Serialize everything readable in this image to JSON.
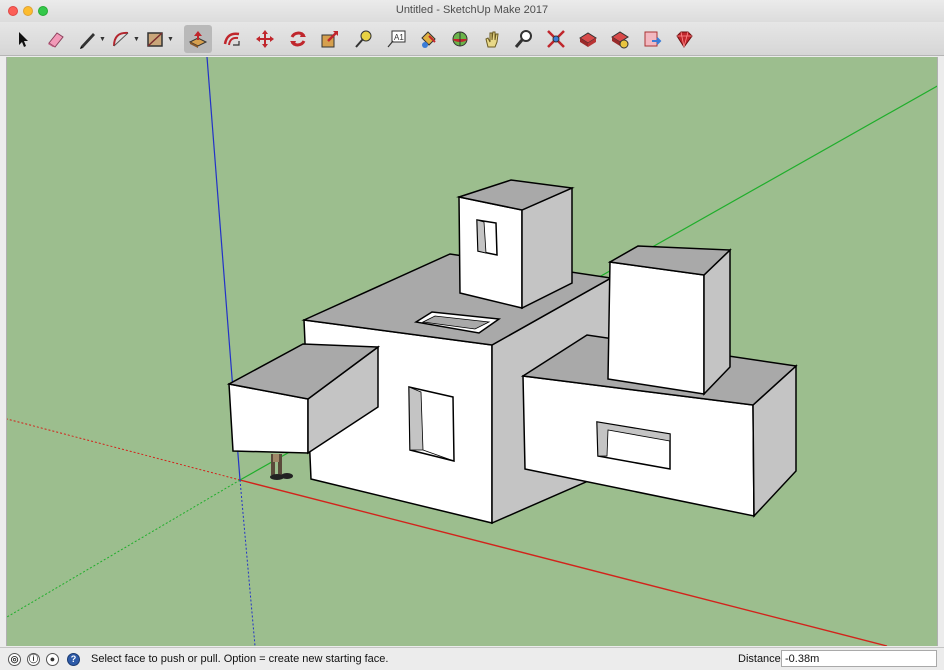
{
  "window": {
    "title": "Untitled - SketchUp Make 2017"
  },
  "toolbar": {
    "tools": [
      {
        "name": "select-tool",
        "icon": "arrow-icon"
      },
      {
        "name": "eraser-tool",
        "icon": "eraser-icon"
      },
      {
        "name": "line-tool",
        "icon": "pencil-icon"
      },
      {
        "name": "arc-tool",
        "icon": "arc-icon"
      },
      {
        "name": "rectangle-tool",
        "icon": "rectangle-icon"
      },
      {
        "name": "push-pull-tool",
        "icon": "push-pull-icon",
        "active": true
      },
      {
        "name": "offset-tool",
        "icon": "offset-icon"
      },
      {
        "name": "move-tool",
        "icon": "move-icon"
      },
      {
        "name": "rotate-tool",
        "icon": "rotate-icon"
      },
      {
        "name": "scale-tool",
        "icon": "scale-icon"
      },
      {
        "name": "tape-measure-tool",
        "icon": "tape-measure-icon"
      },
      {
        "name": "text-tool",
        "icon": "text-icon"
      },
      {
        "name": "paint-bucket-tool",
        "icon": "paint-bucket-icon"
      },
      {
        "name": "orbit-tool",
        "icon": "orbit-icon"
      },
      {
        "name": "pan-tool",
        "icon": "hand-icon"
      },
      {
        "name": "zoom-tool",
        "icon": "magnifier-icon"
      },
      {
        "name": "zoom-extents-tool",
        "icon": "zoom-extents-icon"
      },
      {
        "name": "warehouse-tool",
        "icon": "warehouse-icon"
      },
      {
        "name": "extension-warehouse-tool",
        "icon": "extension-warehouse-icon"
      },
      {
        "name": "send-to-layout-tool",
        "icon": "layout-icon"
      },
      {
        "name": "ruby-console-tool",
        "icon": "ruby-icon"
      }
    ]
  },
  "colors": {
    "ground": "#9cbe8e",
    "axis_red": "#d2231b",
    "axis_green": "#1fae2b",
    "axis_blue": "#2232c8",
    "face_light": "#ffffff",
    "face_shadow": "#c4c4c4",
    "face_top": "#a9a9a9"
  },
  "status": {
    "icons": [
      "geo-location-icon",
      "credits-icon",
      "user-icon",
      "help-icon"
    ],
    "message": "Select face to push or pull. Option = create new starting face."
  },
  "measurements": {
    "label": "Distance",
    "value": "-0.38m"
  }
}
